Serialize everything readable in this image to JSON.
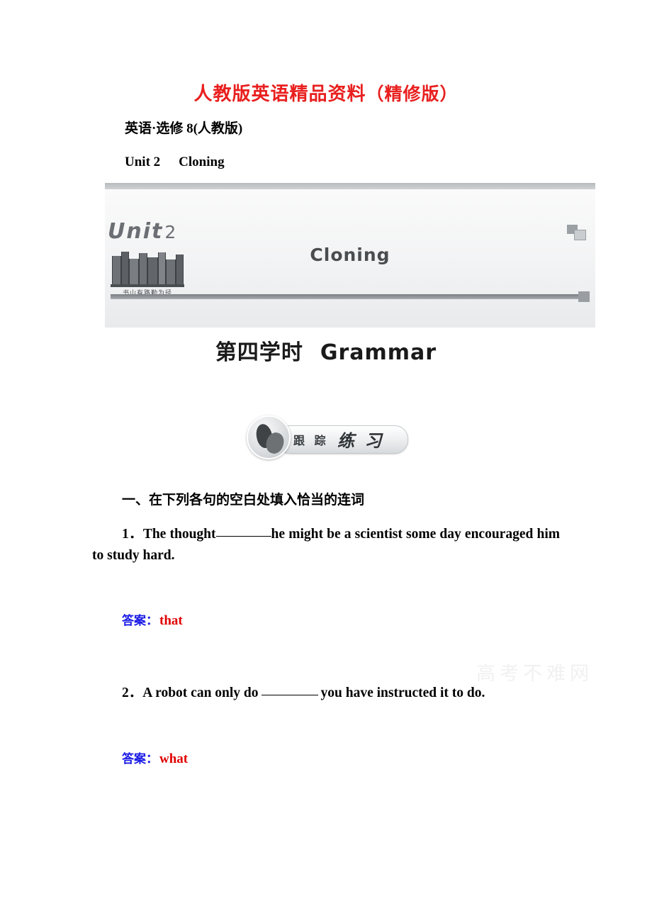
{
  "header": {
    "promo_main": "人教版英语精品资料",
    "promo_paren": "（精修版）",
    "promo_color": "#e8201f",
    "subject_line": "英语·选修 8(人教版)",
    "unit_label": "Unit 2",
    "unit_title": "Cloning"
  },
  "banner": {
    "unit_word": "Unit",
    "unit_number": "2",
    "books_caption": "书山有路勤为径",
    "title": "Cloning"
  },
  "lesson": {
    "period_cn": "第四学时",
    "period_en": "Grammar"
  },
  "badge": {
    "label_cn": "跟 踪",
    "label_en": "练 习"
  },
  "exercise": {
    "section_heading": "一、在下列各句的空白处填入恰当的连词",
    "items": [
      {
        "number": "1．",
        "text_before": "The  thought",
        "text_after": "he  might  be  a  scientist  some  day encouraged him to study hard.",
        "answer_label": "答案：",
        "answer_value": "that"
      },
      {
        "number": "2．",
        "text_before": "A robot can only do",
        "text_after": "you have instructed it to do.",
        "answer_label": "答案：",
        "answer_value": "what"
      }
    ]
  },
  "watermark": {
    "text": "高考不难网"
  }
}
